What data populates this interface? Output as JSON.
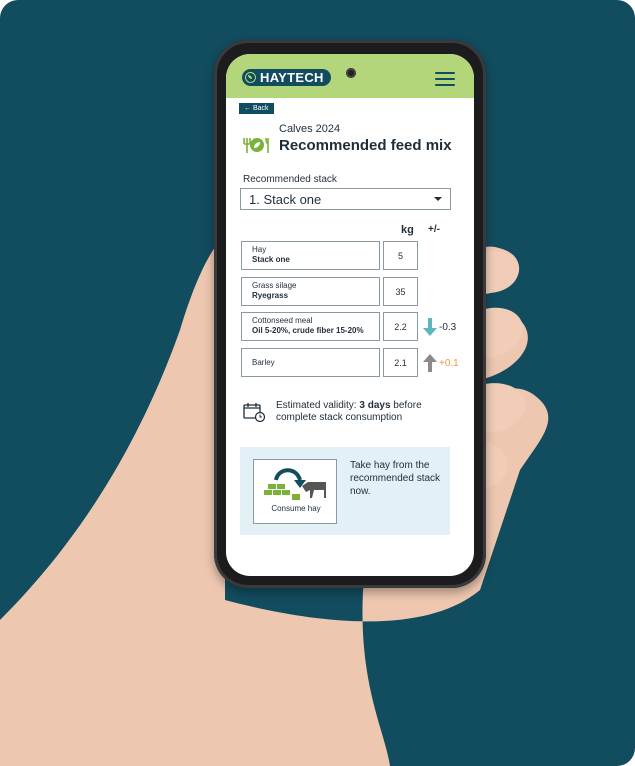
{
  "app": {
    "brand": "HAYTECH"
  },
  "colors": {
    "brand_dark": "#124c5f",
    "brand_green": "#b3d67a",
    "down": "#5bb6bf",
    "up": "#8a8a8a",
    "positive_text": "#f0953a",
    "panel_bg": "#e3f0f5"
  },
  "nav": {
    "back_label": "← Back",
    "menu_icon": "hamburger-icon"
  },
  "header": {
    "subtitle": "Calves 2024",
    "title": "Recommended feed mix",
    "icon": "food-leaf-icon"
  },
  "stack": {
    "label": "Recommended stack",
    "selected": "1. Stack one"
  },
  "table": {
    "col_kg": "kg",
    "col_delta": "+/-",
    "rows": [
      {
        "name": "Hay",
        "detail": "Stack one",
        "kg": "5",
        "delta": "",
        "trend": ""
      },
      {
        "name": "Grass silage",
        "detail": "Ryegrass",
        "kg": "35",
        "delta": "",
        "trend": ""
      },
      {
        "name": "Cottonseed meal",
        "detail": "Oil 5-20%, crude fiber 15-20%",
        "kg": "2.2",
        "delta": "-0.3",
        "trend": "down"
      },
      {
        "name": "Barley",
        "detail": "",
        "kg": "2.1",
        "delta": "+0.1",
        "trend": "up"
      }
    ]
  },
  "validity": {
    "prefix": "Estimated validity: ",
    "value": "3 days",
    "suffix": " before complete stack consumption"
  },
  "action": {
    "button_label": "Consume hay",
    "text": "Take hay from the recommended stack now."
  }
}
